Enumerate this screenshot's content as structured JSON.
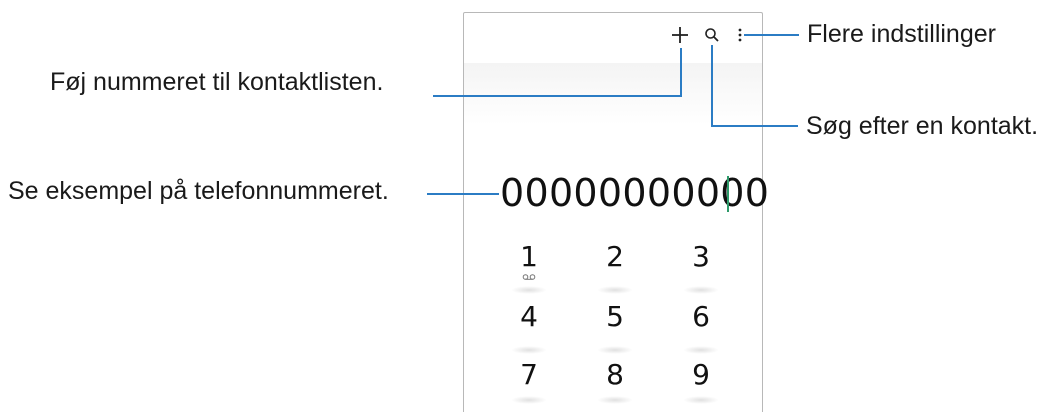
{
  "callouts": {
    "more_options": "Flere indstillinger",
    "add_contact": "Føj nummeret til kontaktlisten.",
    "search_contact": "Søg efter en kontakt.",
    "preview_number": "Se eksempel på telefonnummeret."
  },
  "dialer": {
    "number": "00000000000",
    "icons": {
      "add": "plus-icon",
      "search": "search-icon",
      "more": "more-vertical-icon",
      "voicemail": "voicemail-icon"
    },
    "keys": [
      {
        "digit": "1",
        "sub_icon": "voicemail-icon"
      },
      {
        "digit": "2",
        "sub_icon": ""
      },
      {
        "digit": "3",
        "sub_icon": ""
      },
      {
        "digit": "4",
        "sub_icon": ""
      },
      {
        "digit": "5",
        "sub_icon": ""
      },
      {
        "digit": "6",
        "sub_icon": ""
      },
      {
        "digit": "7",
        "sub_icon": ""
      },
      {
        "digit": "8",
        "sub_icon": ""
      },
      {
        "digit": "9",
        "sub_icon": ""
      }
    ]
  },
  "colors": {
    "leader_line": "#2b7cc4",
    "cursor": "#2e9a6a",
    "frame": "#b8b8b8"
  }
}
